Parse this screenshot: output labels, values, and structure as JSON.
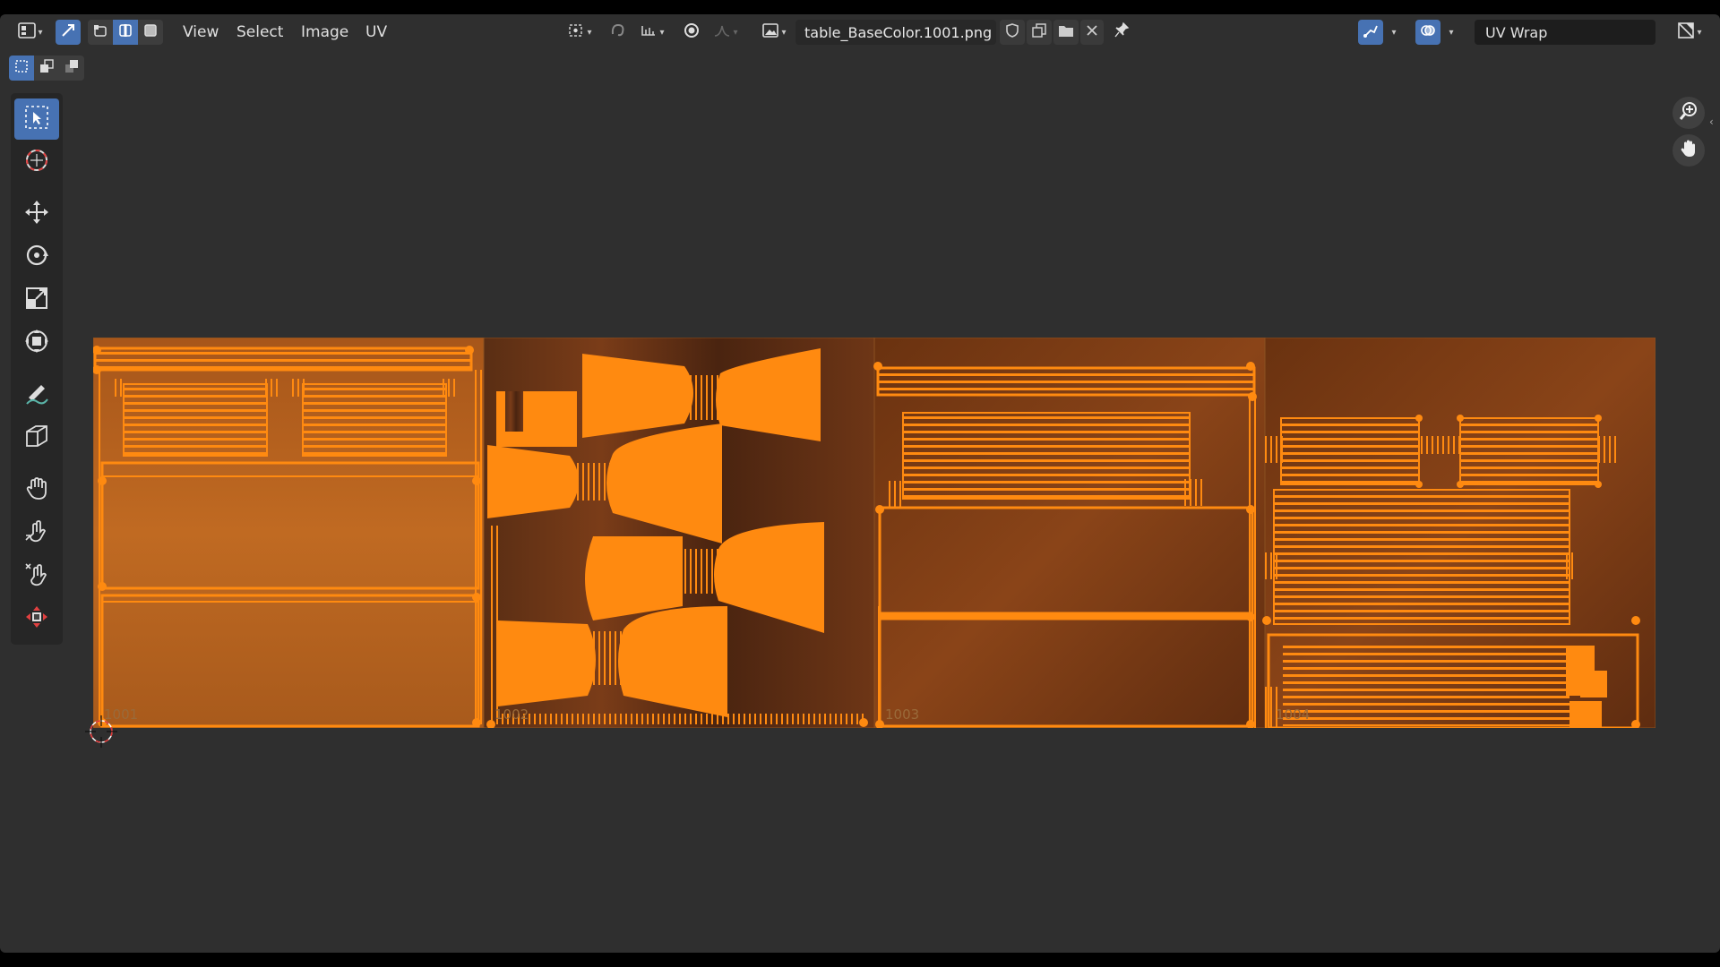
{
  "header": {
    "menus": [
      "View",
      "Select",
      "Image",
      "UV"
    ],
    "image_name": "table_BaseColor.1001.png",
    "uv_map_name": "UV Wrap"
  },
  "tiles": [
    {
      "label": "1001"
    },
    {
      "label": "1002"
    },
    {
      "label": "1003"
    },
    {
      "label": "1004"
    }
  ],
  "icons": {
    "editor_type": "image-editor-icon",
    "sync": "uv-sync-icon",
    "select_modes": [
      "vertex-select-icon",
      "edge-select-icon",
      "face-select-icon"
    ],
    "pin": "pin-icon",
    "snap": "snap-icon",
    "proportional": "proportional-edit-icon",
    "overlay": "overlay-icon",
    "gizmo": "gizmo-icon"
  },
  "colors": {
    "accent": "#4772b3",
    "uv_edge": "#ff8a10",
    "wood": "#b8651e",
    "background": "#2f2f2f"
  }
}
